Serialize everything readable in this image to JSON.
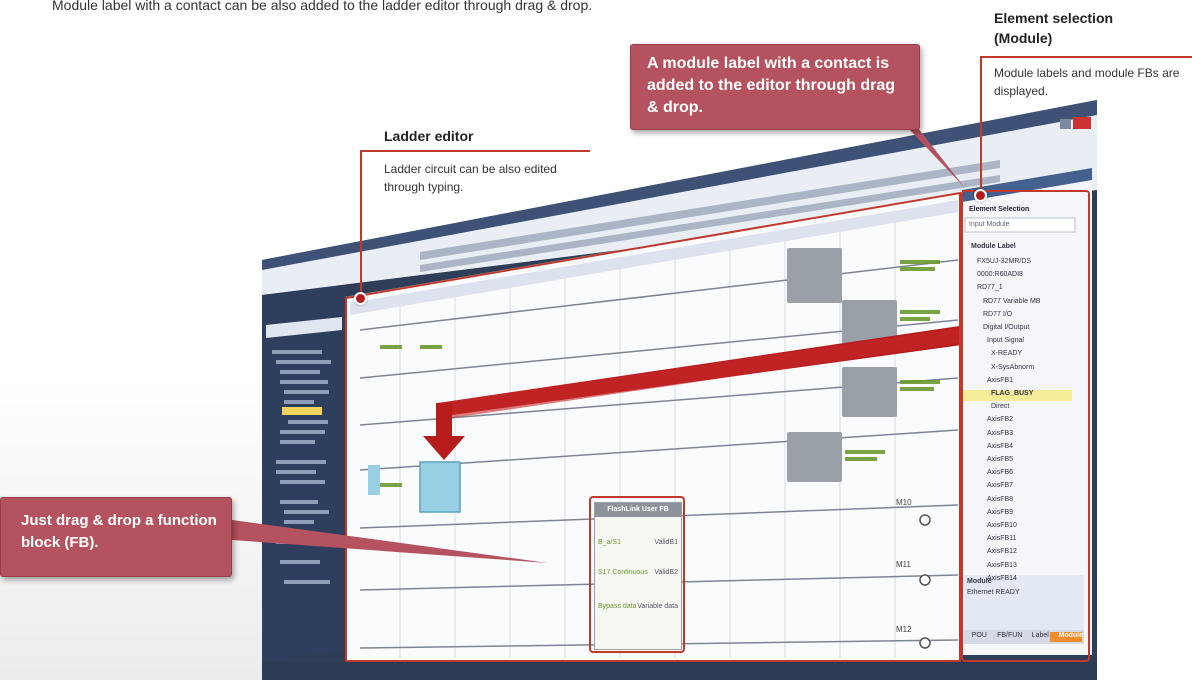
{
  "intro_text": "Module label with a contact can be also added to the ladder editor through drag & drop.",
  "callouts": {
    "module_label": "A module label with a contact is added to the editor through drag & drop.",
    "function_block": "Just drag & drop a function block (FB)."
  },
  "ladder_editor": {
    "heading": "Ladder editor",
    "description": "Ladder circuit can be also edited through typing."
  },
  "element_selection": {
    "heading": "Element selection (Module)",
    "description": "Module labels and module FBs are displayed."
  },
  "element_panel": {
    "title": "Element Selection",
    "search_placeholder": "Input Module",
    "tree_root": "Module Label",
    "tree_items": [
      "FX5UJ-32MR/DS",
      "0000:R60ADI8",
      "RD77_1",
      "RD77 Variable MB",
      "RD77 I/O",
      "Digital I/Output",
      "Input Signal",
      "X-READY",
      "X-SysAbnorm",
      "AxisFB1",
      "FLAG_BUSY",
      "Direct",
      "AxisFB2",
      "AxisFB3",
      "AxisFB4",
      "AxisFB5",
      "AxisFB6",
      "AxisFB7",
      "AxisFB8",
      "AxisFB9",
      "AxisFB10",
      "AxisFB11",
      "AxisFB12",
      "AxisFB13",
      "AxisFB14"
    ],
    "highlighted_item": "FLAG_BUSY",
    "info_label": "Module",
    "info_value": "Ethernet READY",
    "tabs": [
      "POU",
      "FB/FUN",
      "Label",
      "Module"
    ],
    "active_tab": "Module"
  },
  "fb_block": {
    "title": "FlashLink User FB",
    "pins_left": [
      "B_a/S1",
      "S17 Continuous",
      "Bypass data"
    ],
    "pins_right": [
      "ValidB1",
      "ValidB2",
      "Variable data"
    ]
  },
  "coil_labels": [
    "M10",
    "M11",
    "M12"
  ],
  "accent_color": "#b5525f"
}
